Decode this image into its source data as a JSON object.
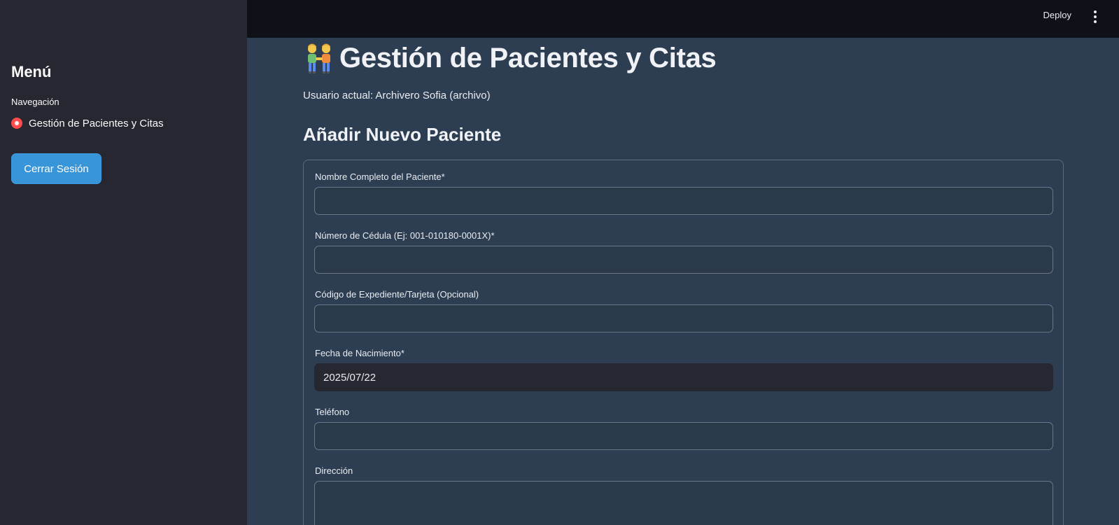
{
  "sidebar": {
    "title": "Menú",
    "nav_label": "Navegación",
    "nav_options": [
      {
        "label": "Gestión de Pacientes y Citas",
        "selected": true
      }
    ],
    "logout_label": "Cerrar Sesión"
  },
  "topbar": {
    "deploy_label": "Deploy",
    "menu_icon": "kebab-menu-icon"
  },
  "main": {
    "title_icon": "people-holding-hands-icon",
    "title": "Gestión de Pacientes y Citas",
    "current_user": "Usuario actual: Archivero Sofia (archivo)",
    "section_title": "Añadir Nuevo Paciente",
    "form": {
      "full_name": {
        "label": "Nombre Completo del Paciente*",
        "value": ""
      },
      "id_number": {
        "label": "Número de Cédula (Ej: 001-010180-0001X)*",
        "value": ""
      },
      "file_code": {
        "label": "Código de Expediente/Tarjeta (Opcional)",
        "value": ""
      },
      "birth_date": {
        "label": "Fecha de Nacimiento*",
        "value": "2025/07/22"
      },
      "phone": {
        "label": "Teléfono",
        "value": ""
      },
      "address": {
        "label": "Dirección",
        "value": ""
      }
    }
  },
  "colors": {
    "accent_radio": "#ff4b4b",
    "button_blue": "#3795d8",
    "main_bg": "#2e3e52",
    "sidebar_bg": "#262730",
    "topbar_bg": "#0e1117"
  }
}
